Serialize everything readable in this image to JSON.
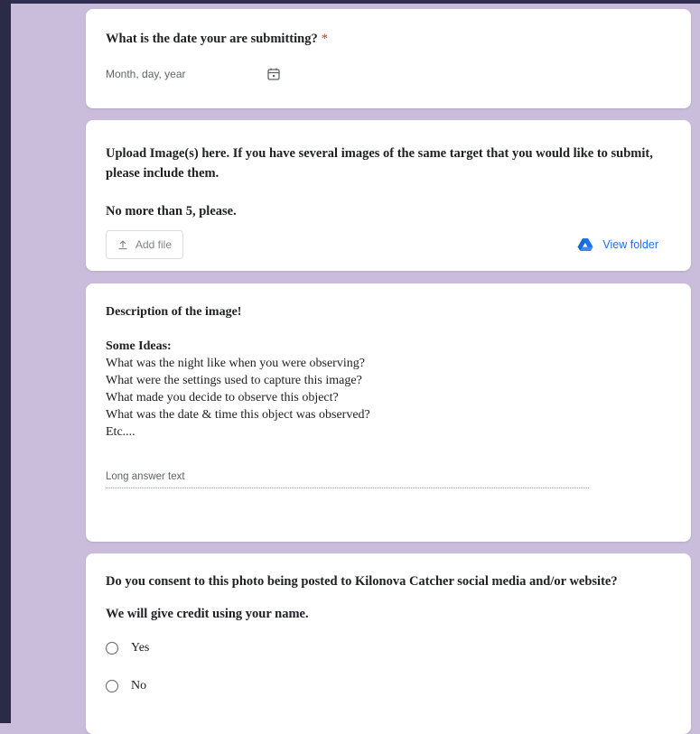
{
  "date_question": {
    "title": "What is the date your are submitting?",
    "required_mark": "*",
    "placeholder": "Month, day, year",
    "icon": "calendar-icon"
  },
  "upload_question": {
    "title_line1": "Upload Image(s) here. If you have several images of the same target that you would like to submit,",
    "title_line2": "please include them.",
    "title_line3": "No more than 5, please.",
    "add_file_label": "Add file",
    "add_file_icon": "upload-icon",
    "view_folder_label": "View folder",
    "view_folder_icon": "drive-icon"
  },
  "description_question": {
    "title": "Description of the image!",
    "ideas_heading": "Some Ideas:",
    "ideas": [
      "What was the night like when you were observing?",
      "What were the settings used to capture this image?",
      "What made you decide to observe this object?",
      "What was the date & time this object was observed?",
      "Etc...."
    ],
    "answer_placeholder": "Long answer text"
  },
  "consent_question": {
    "title": "Do you consent to this photo being posted to Kilonova Catcher social media and/or website?",
    "subtitle": "We will give credit using your name.",
    "options": [
      "Yes",
      "No"
    ]
  },
  "colors": {
    "background": "#c9bddb",
    "required": "#d93025",
    "link": "#1a73e8"
  }
}
